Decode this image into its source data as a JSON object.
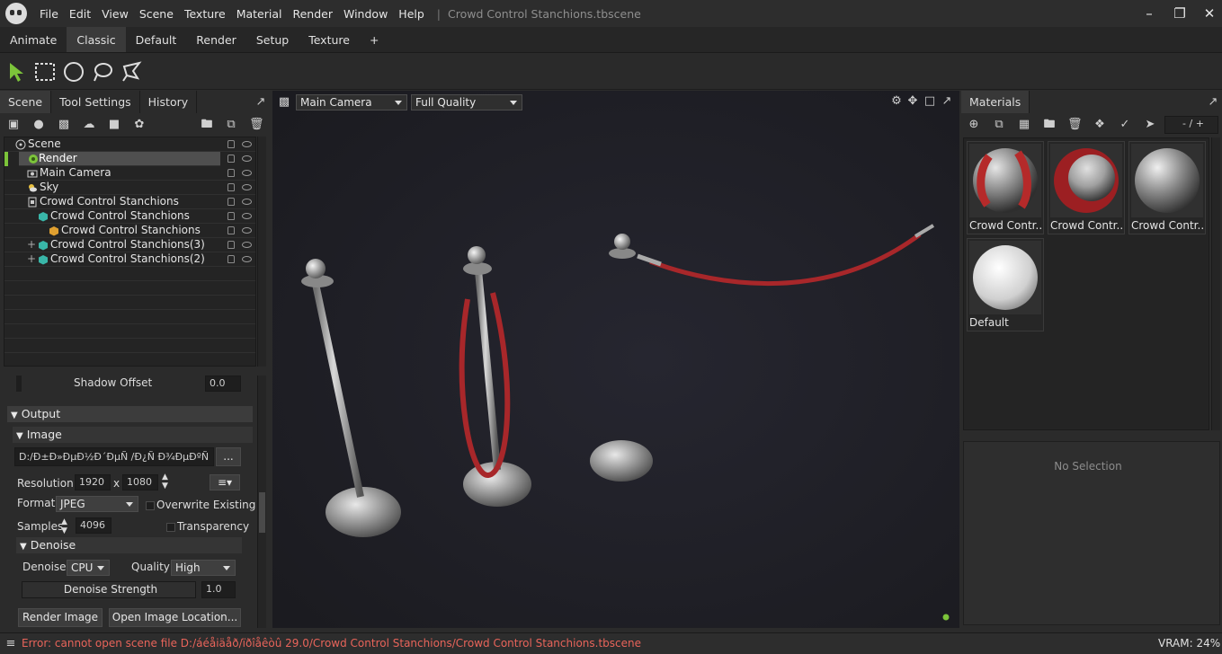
{
  "app": {
    "menu": [
      "File",
      "Edit",
      "View",
      "Scene",
      "Texture",
      "Material",
      "Render",
      "Window",
      "Help"
    ],
    "filename": "Crowd Control Stanchions.tbscene"
  },
  "workspaces": {
    "tabs": [
      "Animate",
      "Classic",
      "Default",
      "Render",
      "Setup",
      "Texture",
      "+"
    ],
    "active": "Classic"
  },
  "left_panel": {
    "tabs": [
      "Scene",
      "Tool Settings",
      "History"
    ],
    "scene_tree": [
      {
        "label": "Scene",
        "icon": "scene-icon"
      },
      {
        "label": "Render",
        "icon": "render-icon",
        "selected": true
      },
      {
        "label": "Main Camera",
        "icon": "camera-icon"
      },
      {
        "label": "Sky",
        "icon": "sky-icon"
      },
      {
        "label": "Crowd Control Stanchions",
        "icon": "model-icon"
      },
      {
        "label": "Crowd Control Stanchions",
        "icon": "mesh-icon"
      },
      {
        "label": "Crowd Control Stanchions",
        "icon": "submesh-icon"
      },
      {
        "label": "Crowd Control Stanchions(3)",
        "icon": "mesh-icon"
      },
      {
        "label": "Crowd Control Stanchions(2)",
        "icon": "mesh-icon"
      }
    ],
    "props": {
      "shadow_offset_label": "Shadow Offset",
      "shadow_offset_value": "0.0",
      "output_label": "Output",
      "image_label": "Image",
      "path_value": "D:/Ð±Ð»ÐµÐ½Ð´ÐµÑ /Ð¿Ñ Ð¾ÐµÐºÑ",
      "browse_label": "...",
      "resolution_label": "Resolution:",
      "res_w": "1920",
      "res_x": "x",
      "res_h": "1080",
      "format_label": "Format",
      "format_value": "JPEG",
      "overwrite_label": "Overwrite Existing",
      "samples_label": "Samples",
      "samples_value": "4096",
      "transparency_label": "Transparency",
      "denoise_header": "Denoise",
      "denoise_label": "Denoise",
      "denoise_value": "CPU",
      "quality_label": "Quality",
      "quality_value": "High",
      "strength_label": "Denoise Strength",
      "strength_value": "1.0",
      "render_button": "Render Image",
      "open_button": "Open Image Location..."
    }
  },
  "viewport": {
    "camera": "Main Camera",
    "quality": "Full Quality"
  },
  "right_panel": {
    "tab": "Materials",
    "counter": "- / +",
    "materials": [
      {
        "label": "Crowd Contr...",
        "style": "red"
      },
      {
        "label": "Crowd Contr...",
        "style": "red2"
      },
      {
        "label": "Crowd Contr...",
        "style": "chrome"
      },
      {
        "label": "Default",
        "style": "white"
      }
    ],
    "no_selection": "No Selection"
  },
  "status": {
    "error": "Error: cannot open scene file D:/áéåiäåð/ïðîåêòû 29.0/Crowd Control Stanchions/Crowd Control Stanchions.tbscene",
    "vram": "VRAM: 24%"
  },
  "colors": {
    "error_text": "#e8645a",
    "accent_green": "#7cc43a",
    "rope_red": "#a8272a"
  }
}
